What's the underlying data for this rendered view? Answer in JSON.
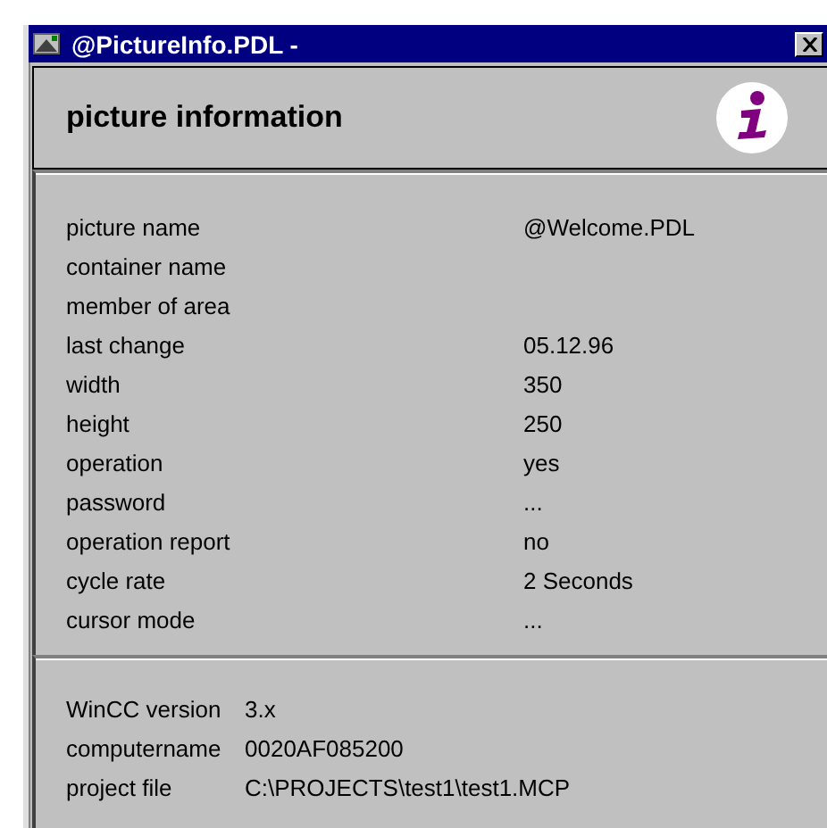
{
  "window": {
    "title": "@PictureInfo.PDL -"
  },
  "header": {
    "title": "picture information"
  },
  "picture_properties": [
    {
      "label": "picture name",
      "value": "@Welcome.PDL"
    },
    {
      "label": "container name"
    },
    {
      "label": "member of area"
    },
    {
      "label": "last change",
      "value": "05.12.96"
    },
    {
      "label": "width",
      "value": "350"
    },
    {
      "label": "height",
      "value": "250"
    },
    {
      "label": "operation",
      "value": "yes"
    },
    {
      "label": "password",
      "value": "..."
    },
    {
      "label": "operation report",
      "value": "no"
    },
    {
      "label": "cycle rate",
      "value": "2 Seconds"
    },
    {
      "label": "cursor mode",
      "value": "..."
    }
  ],
  "system_properties": [
    {
      "label": "WinCC version",
      "value": "3.x"
    },
    {
      "label": "computername",
      "value": "0020AF085200"
    },
    {
      "label": "project file",
      "value": "C:\\PROJECTS\\test1\\test1.MCP"
    }
  ]
}
